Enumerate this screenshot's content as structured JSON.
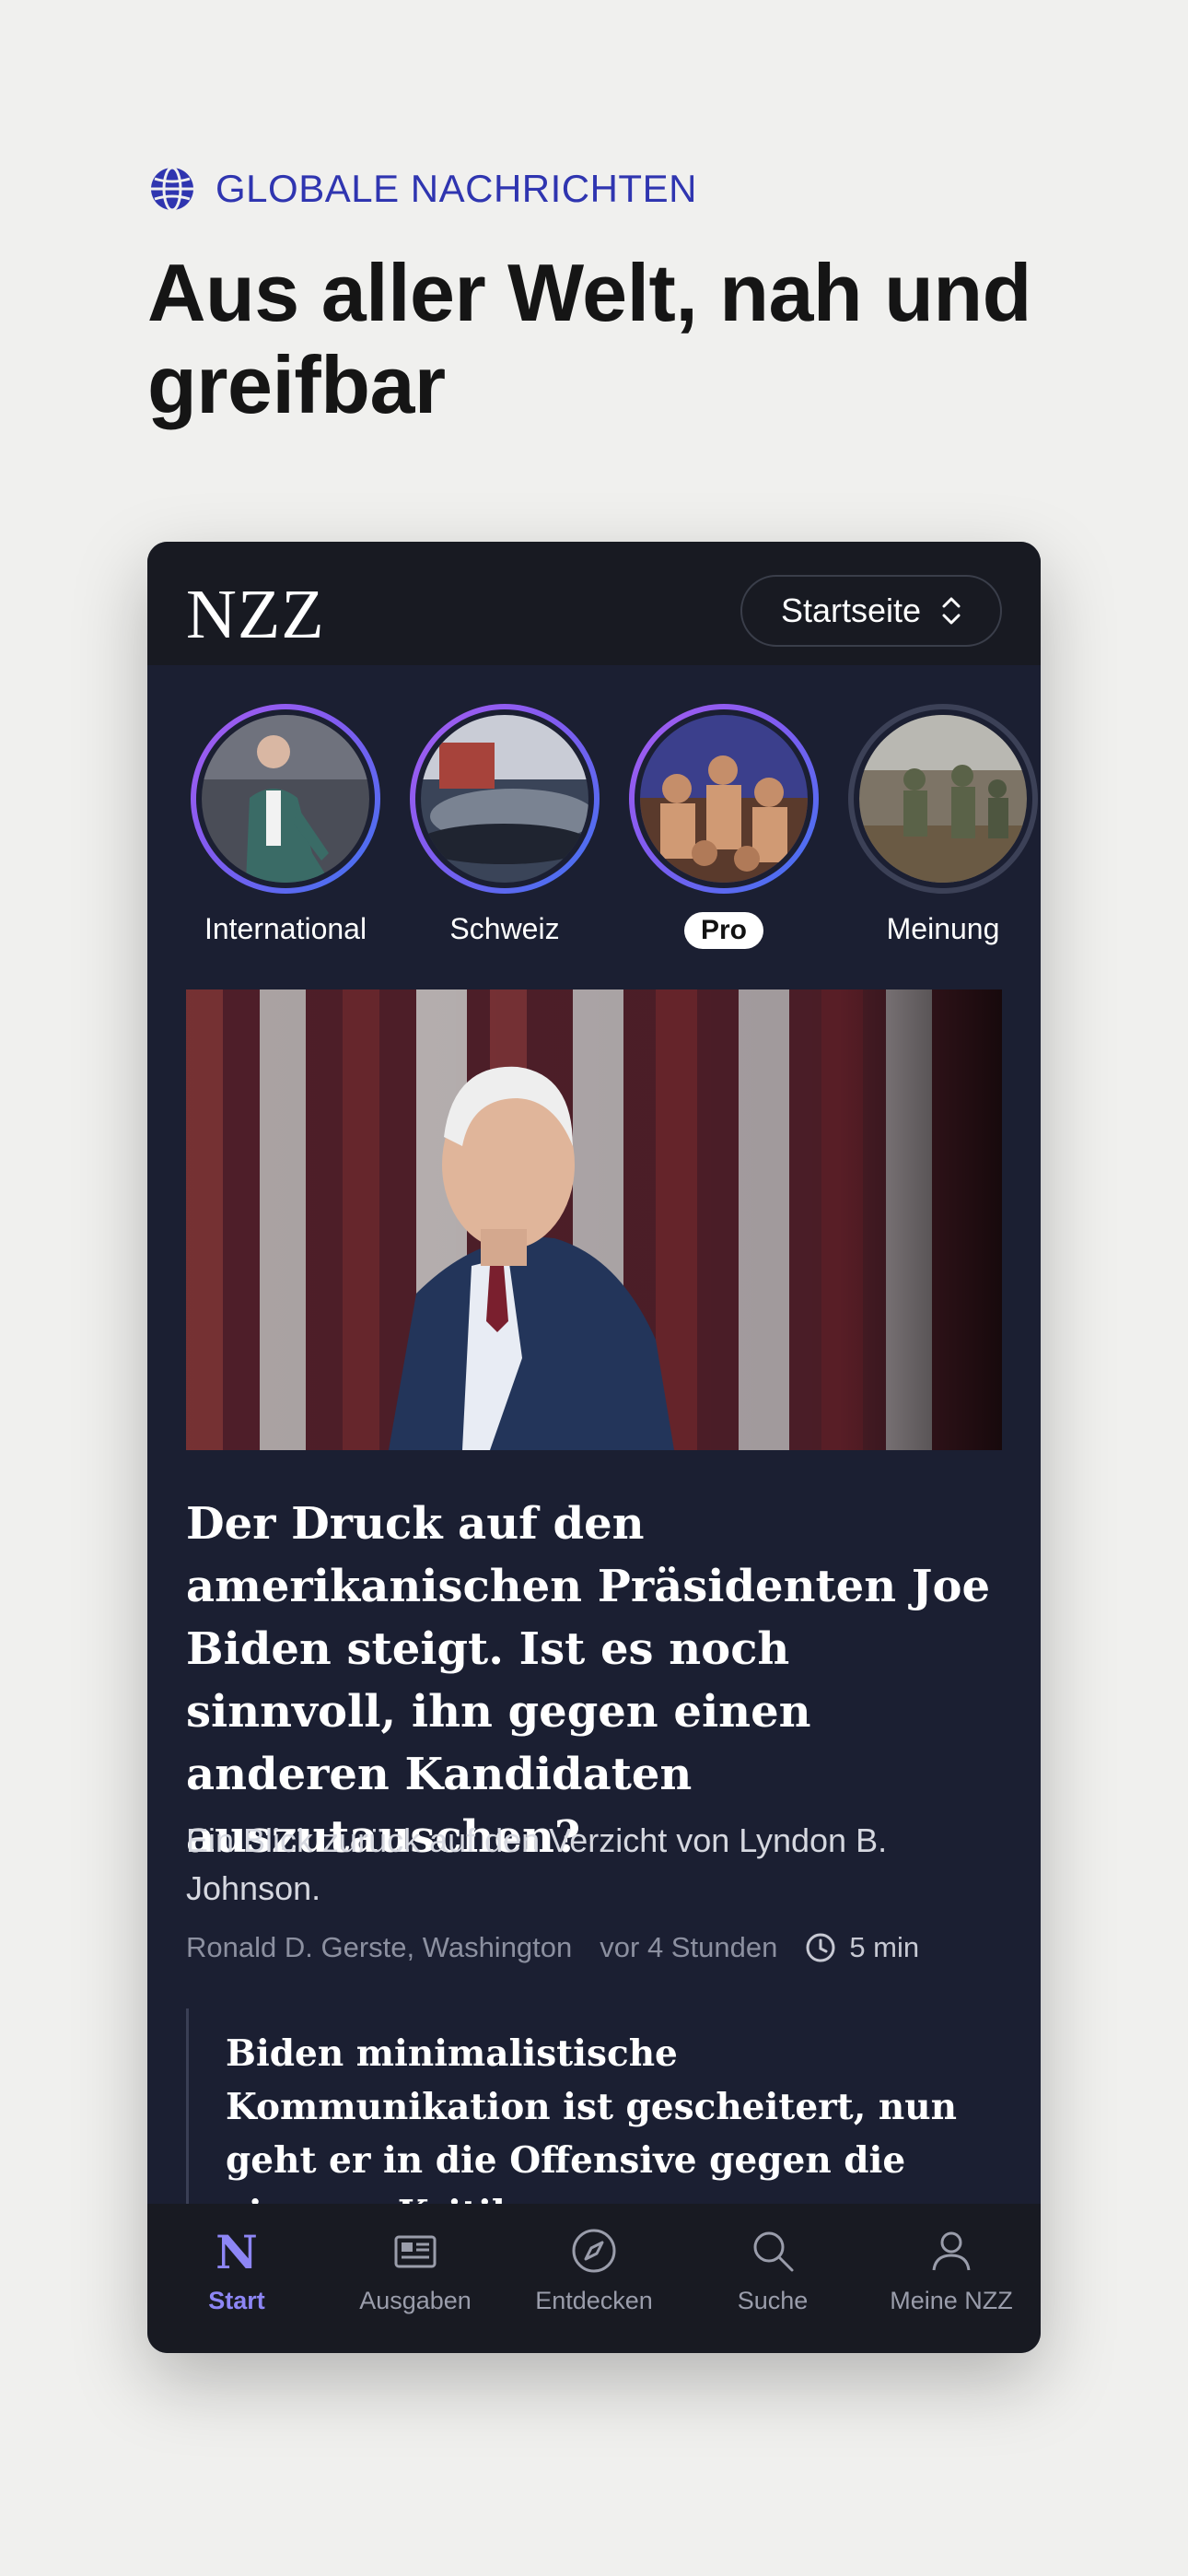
{
  "eyebrow": {
    "icon": "globe-icon",
    "text": "GLOBALE NACHRICHTEN",
    "color": "#2f35b0"
  },
  "headline": "Aus aller Welt, nah und greifbar",
  "app": {
    "logo": "NZZ",
    "selector": {
      "label": "Startseite",
      "icon": "chevron-up-down-icon"
    },
    "stories": [
      {
        "label": "International",
        "active_ring": true
      },
      {
        "label": "Schweiz",
        "active_ring": true
      },
      {
        "label": "Pro",
        "active_ring": true,
        "pill": true
      },
      {
        "label": "Meinung",
        "active_ring": false
      }
    ],
    "article": {
      "title": "Der Druck auf den amerikanischen Präsidenten Joe Biden steigt. Ist es noch sinnvoll, ihn gegen einen anderen Kandidaten auszutauschen?",
      "subtitle": "Ein Blick zurück auf den Verzicht von Lyndon B. Johnson.",
      "author": "Ronald D. Gerste, Washington",
      "published": "vor 4 Stunden",
      "reading_time": "5 min"
    },
    "related": {
      "title": "Biden minimalistische Kommunikation ist gescheitert, nun geht er in die Offensive gegen die eigenen Kritiker"
    },
    "tabs": [
      {
        "label": "Start",
        "icon": "nzz-logo-icon",
        "active": true
      },
      {
        "label": "Ausgaben",
        "icon": "newspaper-icon",
        "active": false
      },
      {
        "label": "Entdecken",
        "icon": "compass-icon",
        "active": false
      },
      {
        "label": "Suche",
        "icon": "search-icon",
        "active": false
      },
      {
        "label": "Meine NZZ",
        "icon": "user-icon",
        "active": false
      }
    ],
    "colors": {
      "accent": "#8d86f5",
      "background": "#1b1f32",
      "bar": "#181a22"
    }
  }
}
